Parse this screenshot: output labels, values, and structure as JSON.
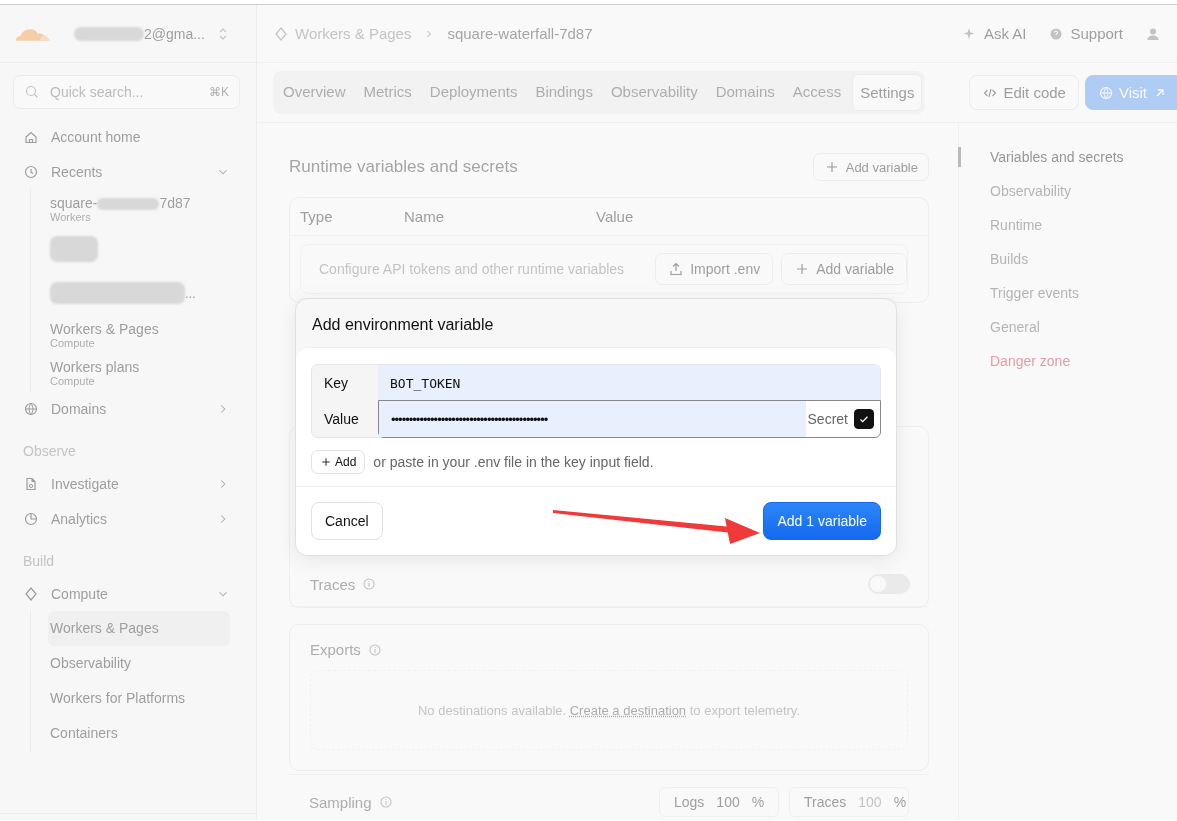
{
  "account": {
    "email": "2@gma..."
  },
  "search": {
    "placeholder": "Quick search...",
    "shortcut": "⌘K"
  },
  "sidebar": {
    "items": [
      {
        "kind": "item",
        "label": "Account home"
      },
      {
        "kind": "item",
        "label": "Recents",
        "expanded": true,
        "children": [
          {
            "kind": "recent",
            "parts": [
              "square-",
              "7d87"
            ],
            "subtitle": "Workers"
          },
          {
            "kind": "redacted"
          },
          {
            "kind": "redacted",
            "tail": "..."
          },
          {
            "kind": "recent",
            "parts": [
              "Workers & Pages"
            ],
            "subtitle": "Compute"
          },
          {
            "kind": "recent",
            "parts": [
              "Workers plans"
            ],
            "subtitle": "Compute"
          }
        ]
      },
      {
        "kind": "item",
        "label": "Domains",
        "expanded": false
      },
      {
        "kind": "section",
        "label": "Observe"
      },
      {
        "kind": "item",
        "label": "Investigate",
        "expanded": false
      },
      {
        "kind": "item",
        "label": "Analytics",
        "expanded": false
      },
      {
        "kind": "section",
        "label": "Build"
      },
      {
        "kind": "item",
        "label": "Compute",
        "expanded": true,
        "children": [
          {
            "kind": "sub",
            "label": "Workers & Pages",
            "selected": true
          },
          {
            "kind": "sub",
            "label": "Observability",
            "selected": false
          },
          {
            "kind": "sub",
            "label": "Workers for Platforms",
            "selected": false
          },
          {
            "kind": "sub",
            "label": "Containers",
            "selected": false
          }
        ]
      }
    ]
  },
  "breadcrumb": [
    {
      "label": "Workers & Pages"
    },
    {
      "label": "square-waterfall-7d87"
    }
  ],
  "header_actions": [
    {
      "label": "Ask AI",
      "kind": "ai"
    },
    {
      "label": "Support",
      "kind": "support"
    },
    {
      "kind": "user"
    }
  ],
  "tabs": [
    {
      "label": "Overview",
      "selected": false
    },
    {
      "label": "Metrics",
      "selected": false
    },
    {
      "label": "Deployments",
      "selected": false
    },
    {
      "label": "Bindings",
      "selected": false
    },
    {
      "label": "Observability",
      "selected": false
    },
    {
      "label": "Domains",
      "selected": false
    },
    {
      "label": "Access",
      "selected": false
    },
    {
      "label": "Settings",
      "selected": true
    }
  ],
  "page_buttons": [
    {
      "label": "Edit code",
      "kind": "secondary"
    },
    {
      "label": "Visit",
      "kind": "primary"
    }
  ],
  "variables": {
    "title": "Runtime variables and secrets",
    "add_button": "Add variable",
    "columns": [
      "Type",
      "Name",
      "Value"
    ],
    "empty_text": "Configure API tokens and other runtime variables",
    "import_button": "Import .env",
    "empty_add_button": "Add variable"
  },
  "traces": {
    "label": "Traces",
    "on": false
  },
  "exports": {
    "label": "Exports",
    "text_before": "No destinations available.",
    "link": "Create a destination",
    "text_after": "to export telemetry."
  },
  "sampling": {
    "label": "Sampling",
    "fields": [
      {
        "label": "Logs",
        "value": "100",
        "unit": "%",
        "disabled": false
      },
      {
        "label": "Traces",
        "value": "100",
        "unit": "%",
        "disabled": true
      }
    ]
  },
  "settings_nav": [
    {
      "label": "Variables and secrets",
      "selected": true,
      "kind": "normal"
    },
    {
      "label": "Observability",
      "selected": false,
      "kind": "normal"
    },
    {
      "label": "Runtime",
      "selected": false,
      "kind": "normal"
    },
    {
      "label": "Builds",
      "selected": false,
      "kind": "normal"
    },
    {
      "label": "Trigger events",
      "selected": false,
      "kind": "normal"
    },
    {
      "label": "General",
      "selected": false,
      "kind": "normal"
    },
    {
      "label": "Danger zone",
      "selected": false,
      "kind": "danger"
    }
  ],
  "dialog": {
    "title": "Add environment variable",
    "key_label": "Key",
    "key_value": "BOT_TOKEN",
    "value_label": "Value",
    "value_value": "••••••••••••••••••••••••••••••••••••••••••••",
    "secret_label": "Secret",
    "secret_checked": true,
    "add_button": "Add",
    "hint": "or paste in your .env file in the key input field.",
    "cancel_button": "Cancel",
    "submit_button": "Add 1 variable"
  }
}
